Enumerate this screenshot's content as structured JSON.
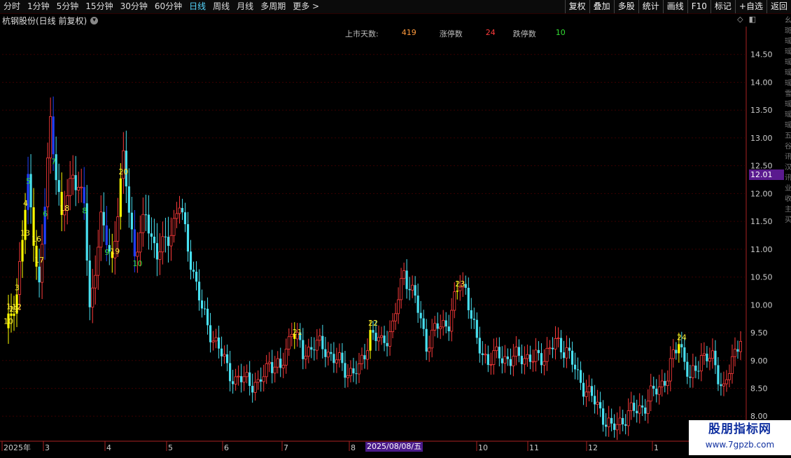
{
  "toolbar": {
    "tabs": [
      "分时",
      "1分钟",
      "5分钟",
      "15分钟",
      "30分钟",
      "60分钟",
      "日线",
      "周线",
      "月线",
      "多周期",
      "更多 >"
    ],
    "active_index": 6,
    "right_buttons": [
      "复权",
      "叠加",
      "多股",
      "统计",
      "画线",
      "F10",
      "标记",
      "+自选",
      "返回"
    ]
  },
  "stock": {
    "title": "杭钢股份(日线 前复权)"
  },
  "stats": {
    "listed_days_label": "上市天数:",
    "listed_days_value": "419",
    "limit_up_label": "涨停数",
    "limit_up_value": "24",
    "limit_down_label": "跌停数",
    "limit_down_value": "10"
  },
  "price_tag": "12.01",
  "date_highlight": "2025/08/08/五",
  "right_strip_text": "幺斑瑶瑶瑶瑶瑶雪瑶瑶瑶五谷讯汉讯业收主买",
  "colors": {
    "up": "#ff3b3b",
    "down": "#48e0f0",
    "limitup": "#ffff00",
    "limitdown": "#2040ff",
    "grid": "#3a0000",
    "axis": "#aa2222"
  },
  "watermark": {
    "line1": "股朋指标网",
    "line2": "www.7gpzb.com"
  },
  "chart_data": {
    "type": "candlestick",
    "ylim": [
      7.6,
      15.0
    ],
    "y_ticks": [
      8.0,
      8.5,
      9.0,
      9.5,
      10.0,
      10.5,
      11.0,
      11.5,
      12.0,
      12.5,
      13.0,
      13.5,
      14.0,
      14.5
    ],
    "x_labels": [
      "2025年",
      "3",
      "4",
      "5",
      "6",
      "7",
      "8",
      "10",
      "11",
      "12",
      "1"
    ],
    "anchors": [
      [
        0,
        9.5
      ],
      [
        4,
        10.2
      ],
      [
        8,
        12.2
      ],
      [
        12,
        10.3
      ],
      [
        16,
        13.3
      ],
      [
        20,
        11.5
      ],
      [
        24,
        12.4
      ],
      [
        28,
        11.8
      ],
      [
        30,
        9.9
      ],
      [
        34,
        11.5
      ],
      [
        38,
        10.8
      ],
      [
        42,
        12.6
      ],
      [
        46,
        10.9
      ],
      [
        50,
        11.6
      ],
      [
        54,
        10.9
      ],
      [
        58,
        11.2
      ],
      [
        62,
        11.8
      ],
      [
        66,
        10.8
      ],
      [
        70,
        9.9
      ],
      [
        74,
        9.4
      ],
      [
        78,
        9.0
      ],
      [
        82,
        8.6
      ],
      [
        86,
        8.7
      ],
      [
        90,
        8.5
      ],
      [
        94,
        9.0
      ],
      [
        98,
        8.8
      ],
      [
        102,
        9.6
      ],
      [
        106,
        9.1
      ],
      [
        110,
        9.3
      ],
      [
        114,
        9.2
      ],
      [
        118,
        9.0
      ],
      [
        122,
        8.8
      ],
      [
        126,
        8.8
      ],
      [
        130,
        9.5
      ],
      [
        134,
        9.3
      ],
      [
        138,
        9.6
      ],
      [
        142,
        10.6
      ],
      [
        146,
        10.1
      ],
      [
        150,
        9.3
      ],
      [
        154,
        9.6
      ],
      [
        158,
        9.7
      ],
      [
        162,
        10.4
      ],
      [
        164,
        10.3
      ],
      [
        168,
        9.3
      ],
      [
        172,
        9.0
      ],
      [
        176,
        9.1
      ],
      [
        180,
        9.0
      ],
      [
        184,
        9.1
      ],
      [
        188,
        9.0
      ],
      [
        192,
        9.1
      ],
      [
        196,
        9.3
      ],
      [
        200,
        9.2
      ],
      [
        204,
        8.7
      ],
      [
        208,
        8.4
      ],
      [
        212,
        8.1
      ],
      [
        216,
        7.75
      ],
      [
        220,
        7.95
      ],
      [
        224,
        8.1
      ],
      [
        228,
        8.2
      ],
      [
        232,
        8.5
      ],
      [
        236,
        8.7
      ],
      [
        240,
        9.4
      ],
      [
        244,
        8.6
      ],
      [
        248,
        9.1
      ],
      [
        252,
        9.0
      ],
      [
        256,
        8.5
      ],
      [
        260,
        9.1
      ],
      [
        262,
        9.5
      ]
    ],
    "markers": [
      {
        "i": 1,
        "label": "1",
        "kind": "up"
      },
      {
        "i": 2,
        "label": "2",
        "kind": "up"
      },
      {
        "i": 4,
        "label": "3",
        "kind": "up"
      },
      {
        "i": 7,
        "label": "4",
        "kind": "up"
      },
      {
        "i": 8,
        "label": "5",
        "kind": "down"
      },
      {
        "i": 14,
        "label": "6",
        "kind": "down"
      },
      {
        "i": 17,
        "label": "7",
        "kind": "down"
      },
      {
        "i": 28,
        "label": "8",
        "kind": "down"
      },
      {
        "i": 36,
        "label": "9",
        "kind": "down"
      },
      {
        "i": 46,
        "label": "10",
        "kind": "down"
      },
      {
        "i": 2,
        "label": "11",
        "kind": "up"
      },
      {
        "i": 3,
        "label": "12",
        "kind": "up"
      },
      {
        "i": 6,
        "label": "13",
        "kind": "up"
      },
      {
        "i": 10,
        "label": "16",
        "kind": "up"
      },
      {
        "i": 11,
        "label": "17",
        "kind": "up"
      },
      {
        "i": 20,
        "label": "18",
        "kind": "up"
      },
      {
        "i": 38,
        "label": "19",
        "kind": "up"
      },
      {
        "i": 41,
        "label": "20",
        "kind": "up"
      },
      {
        "i": 103,
        "label": "21",
        "kind": "up"
      },
      {
        "i": 130,
        "label": "22",
        "kind": "up"
      },
      {
        "i": 161,
        "label": "23",
        "kind": "up"
      },
      {
        "i": 240,
        "label": "24",
        "kind": "up"
      },
      {
        "i": 0,
        "label": "10",
        "kind": "up"
      }
    ]
  }
}
